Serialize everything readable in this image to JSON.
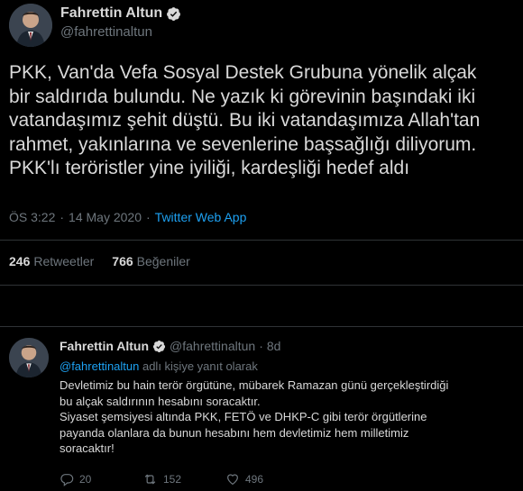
{
  "main_tweet": {
    "author_name": "Fahrettin Altun",
    "author_handle": "@fahrettinaltun",
    "text": "PKK, Van'da Vefa Sosyal Destek Grubuna yönelik alçak\nbir saldırıda bulundu. Ne yazık ki görevinin başındaki iki\nvatandaşımız şehit düştü. Bu iki vatandaşımıza Allah'tan\nrahmet, yakınlarına ve sevenlerine başsağlığı diliyorum.\nPKK'lı teröristler yine iyiliği, kardeşliği hedef aldı",
    "time": "ÖS 3:22",
    "separator1": "·",
    "date": "14 May 2020",
    "separator2": "·",
    "app": "Twitter Web App",
    "retweets_count": "246",
    "retweets_label": "Retweetler",
    "likes_count": "766",
    "likes_label": "Beğeniler"
  },
  "reply_tweet": {
    "author_name": "Fahrettin Altun",
    "author_handle": "@fahrettinaltun",
    "separator": "·",
    "age": "8d",
    "reply_mention": "@fahrettinaltun",
    "reply_suffix": " adlı kişiye yanıt olarak",
    "text": "Devletimiz bu hain terör örgütüne, mübarek Ramazan günü gerçekleştirdiği\nbu alçak saldırının hesabını soracaktır.\nSiyaset şemsiyesi altında PKK, FETÖ ve DHKP-C gibi terör örgütlerine\npayanda olanlara da bunun hesabını hem devletimiz hem milletimiz\nsoracaktır!",
    "replies": "20",
    "retweets": "152",
    "likes": "496"
  },
  "colors": {
    "background": "#000000",
    "text": "#d9d9d9",
    "muted": "#6e767d",
    "accent": "#1da1f2",
    "divider": "#2f3336"
  },
  "icons": {
    "verified": "verified-badge-icon",
    "reply": "reply-icon",
    "retweet": "retweet-icon",
    "like": "heart-icon"
  }
}
